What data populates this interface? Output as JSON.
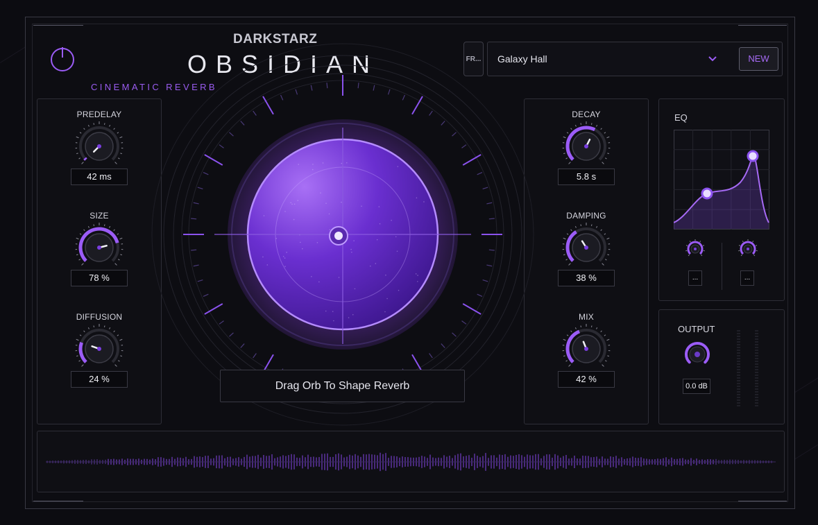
{
  "brand": "DARKSTARZ",
  "product": "OBSIDIAN",
  "subtitle": "CINEMATIC REVERB",
  "preset": {
    "button_label": "FR...",
    "name": "Galaxy Hall",
    "new_label": "NEW"
  },
  "left_knobs": [
    {
      "id": "predelay",
      "label": "PREDELAY",
      "value": "42 ms",
      "level": 0.0
    },
    {
      "id": "size",
      "label": "SIZE",
      "value": "78 %",
      "level": 0.78
    },
    {
      "id": "diffusion",
      "label": "DIFFUSION",
      "value": "24 %",
      "level": 0.24
    }
  ],
  "right_knobs": [
    {
      "id": "decay",
      "label": "DECAY",
      "value": "5.8 s",
      "level": 0.6
    },
    {
      "id": "damping",
      "label": "DAMPING",
      "value": "38 %",
      "level": 0.38
    },
    {
      "id": "mix",
      "label": "MIX",
      "value": "42 %",
      "level": 0.42
    }
  ],
  "orb": {
    "hint": "Drag Orb To Shape Reverb"
  },
  "eq": {
    "title": "EQ",
    "low_value": "...",
    "high_value": "..."
  },
  "output": {
    "title": "OUTPUT",
    "value": "0.0 dB"
  },
  "colors": {
    "accent": "#9b5cf6",
    "accent_light": "#c8a6ff",
    "panel_bg": "#0f0f14",
    "background": "#0c0c11"
  }
}
